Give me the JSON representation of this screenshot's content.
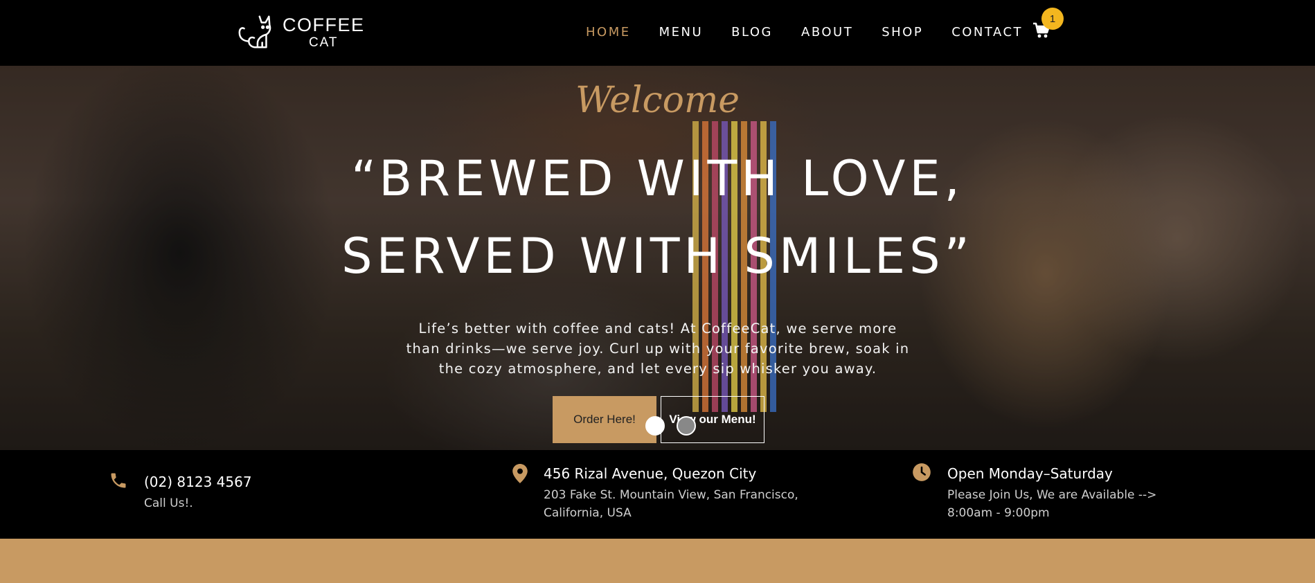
{
  "header": {
    "logo": {
      "line1": "COFFEE",
      "line2": "CAT"
    },
    "nav": [
      {
        "label": "HOME",
        "active": true
      },
      {
        "label": "MENU",
        "active": false
      },
      {
        "label": "BLOG",
        "active": false
      },
      {
        "label": "ABOUT",
        "active": false
      },
      {
        "label": "SHOP",
        "active": false
      },
      {
        "label": "CONTACT",
        "active": false
      }
    ],
    "cart": {
      "icon": "cart-icon",
      "count": "1"
    }
  },
  "hero": {
    "welcome": "Welcome",
    "headline_line1": "“BREWED WITH LOVE,",
    "headline_line2": "SERVED WITH SMILES”",
    "lead": "Life’s better with coffee and cats! At CoffeeCat, we serve more than drinks—we serve joy. Curl up with your favorite brew, soak in the cozy atmosphere, and let every sip whisker you away.",
    "primary_button": "Order Here!",
    "secondary_button": "View our Menu!",
    "slides": {
      "count": 2,
      "active": 1
    }
  },
  "info": {
    "phone": {
      "icon": "phone-icon",
      "title": "(02) 8123 4567",
      "sub": "Call Us!."
    },
    "address": {
      "icon": "location-pin-icon",
      "title": "456 Rizal Avenue, Quezon City",
      "sub_line1": "203 Fake St. Mountain View, San Francisco,",
      "sub_line2": "California, USA"
    },
    "hours": {
      "icon": "clock-icon",
      "title": "Open Monday–Saturday",
      "sub_line1": "Please Join Us, We are Available -->",
      "sub_line2": "8:00am - 9:00pm"
    }
  },
  "colors": {
    "accent": "#c89a62",
    "badge": "#f3b61f",
    "background": "#000000"
  }
}
